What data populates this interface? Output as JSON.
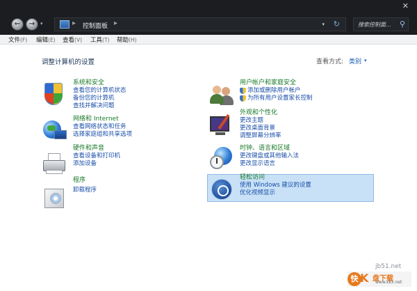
{
  "window": {
    "close_glyph": "✕"
  },
  "nav": {
    "back_glyph": "←",
    "forward_glyph": "→",
    "dropdown_glyph": "▾",
    "address": {
      "separator1": "▸",
      "path": "控制面板",
      "separator2": "▸",
      "dropdown_glyph": "▾",
      "refresh_glyph": "↻"
    },
    "search": {
      "placeholder": "搜索控制面...",
      "icon_glyph": "⚲"
    }
  },
  "menu": [
    {
      "label": "文件",
      "accel": "(F)"
    },
    {
      "label": "编辑",
      "accel": "(E)"
    },
    {
      "label": "查看",
      "accel": "(V)"
    },
    {
      "label": "工具",
      "accel": "(T)"
    },
    {
      "label": "帮助",
      "accel": "(H)"
    }
  ],
  "content": {
    "heading": "调整计算机的设置",
    "view_by_label": "查看方式:",
    "view_by_value": "类别",
    "view_by_glyph": "▾"
  },
  "categories_left": [
    {
      "title": "系统和安全",
      "icon": "shield-icon",
      "links": [
        "查看您的计算机状态",
        "备份您的计算机",
        "查找并解决问题"
      ]
    },
    {
      "title": "网络和 Internet",
      "icon": "network-icon",
      "links": [
        "查看网络状态和任务",
        "选择家庭组和共享选项"
      ]
    },
    {
      "title": "硬件和声音",
      "icon": "printer-icon",
      "links": [
        "查看设备和打印机",
        "添加设备"
      ]
    },
    {
      "title": "程序",
      "icon": "programs-icon",
      "links": [
        "卸载程序"
      ]
    }
  ],
  "categories_right": [
    {
      "title": "用户帐户和家庭安全",
      "icon": "users-icon",
      "links": [
        "添加或删除用户帐户",
        "为所有用户设置家长控制"
      ],
      "shield_links": true
    },
    {
      "title": "外观和个性化",
      "icon": "appearance-icon",
      "links": [
        "更改主题",
        "更改桌面背景",
        "调整屏幕分辨率"
      ],
      "shield_links": false
    },
    {
      "title": "时钟、语言和区域",
      "icon": "clock-globe-icon",
      "links": [
        "更改键盘或其他输入法",
        "更改显示语言"
      ],
      "shield_links": false
    },
    {
      "title": "轻松访问",
      "icon": "ease-of-access-icon",
      "links": [
        "使用 Windows 建议的设置",
        "优化视频显示"
      ],
      "shield_links": false
    }
  ],
  "watermark": {
    "site": "jb51.net",
    "mark": "快",
    "k": "K",
    "brand": "盘下载",
    "tagline": "www.kkx.net"
  },
  "colors": {
    "title_green": "#1a7a2a",
    "link_blue": "#1a4ea8",
    "highlight": "#c8e1f6",
    "chrome_dark": "#1b1d21"
  }
}
